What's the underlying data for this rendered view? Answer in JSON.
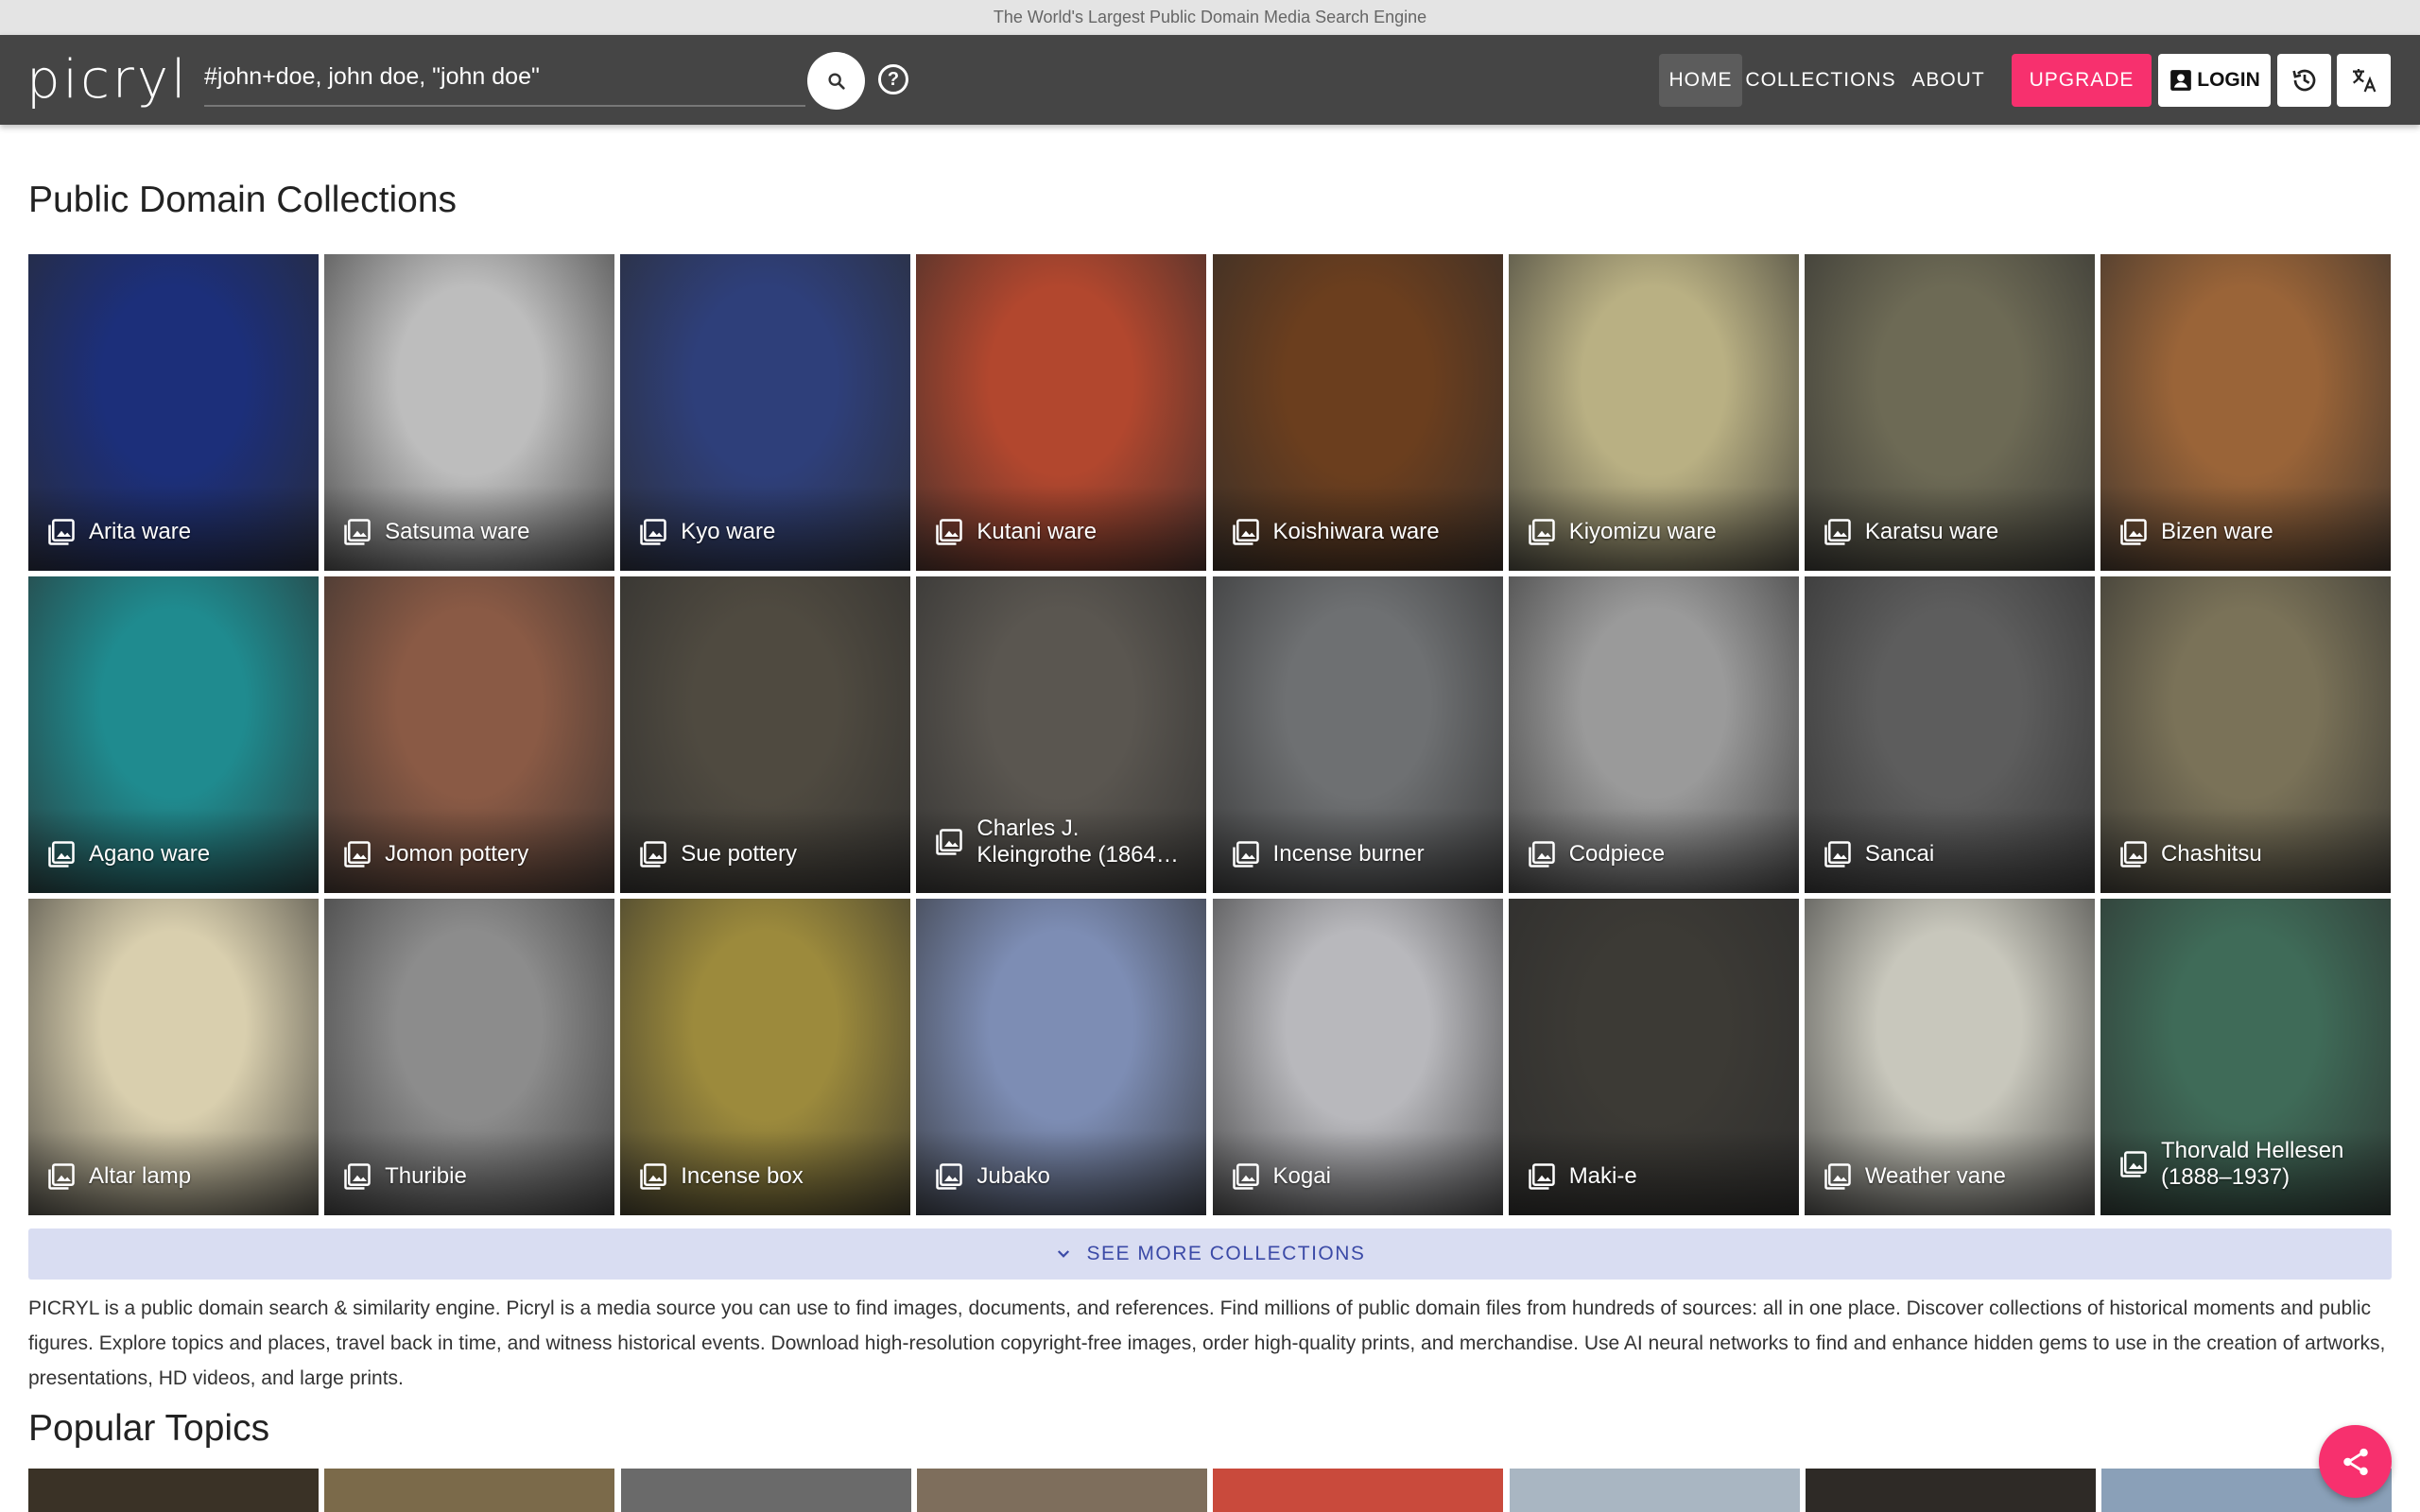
{
  "banner": {
    "text": "The World's Largest Public Domain Media Search Engine"
  },
  "header": {
    "logo": "picryl",
    "search_value": "#john+doe, john doe, \"john doe\"",
    "nav": [
      "HOME",
      "COLLECTIONS",
      "ABOUT"
    ],
    "upgrade": "UPGRADE",
    "login": "LOGIN"
  },
  "collections": {
    "title": "Public Domain Collections",
    "items": [
      {
        "label": "Arita ware",
        "bg": "#1c2f7a"
      },
      {
        "label": "Satsuma ware",
        "bg": "#bdbdbd"
      },
      {
        "label": "Kyo ware",
        "bg": "#2e3f7a"
      },
      {
        "label": "Kutani ware",
        "bg": "#b2472e"
      },
      {
        "label": "Koishiwara ware",
        "bg": "#6b3e1e"
      },
      {
        "label": "Kiyomizu ware",
        "bg": "#b9b083"
      },
      {
        "label": "Karatsu ware",
        "bg": "#6d6a55"
      },
      {
        "label": "Bizen ware",
        "bg": "#9a6438"
      },
      {
        "label": "Agano ware",
        "bg": "#1f8b8f"
      },
      {
        "label": "Jomon pottery",
        "bg": "#8a5a45"
      },
      {
        "label": "Sue pottery",
        "bg": "#4f4a40"
      },
      {
        "label": "Charles J. Kleingrothe (1864…",
        "bg": "#5a5650"
      },
      {
        "label": "Incense burner",
        "bg": "#6e7072"
      },
      {
        "label": "Codpiece",
        "bg": "#9a9a9a"
      },
      {
        "label": "Sancai",
        "bg": "#5d5d5d"
      },
      {
        "label": "Chashitsu",
        "bg": "#7a7258"
      },
      {
        "label": "Altar lamp",
        "bg": "#d9cfae"
      },
      {
        "label": "Thuribie",
        "bg": "#8c8c8c"
      },
      {
        "label": "Incense box",
        "bg": "#9c8a3c"
      },
      {
        "label": "Jubako",
        "bg": "#7d8db4"
      },
      {
        "label": "Kogai",
        "bg": "#b8b8bc"
      },
      {
        "label": "Maki-e",
        "bg": "#3c3a35"
      },
      {
        "label": "Weather vane",
        "bg": "#c8c7bc"
      },
      {
        "label": "Thorvald Hellesen (1888–1937)",
        "bg": "#3f6b58"
      }
    ]
  },
  "see_more": "SEE MORE COLLECTIONS",
  "description": "PICRYL is a public domain search & similarity engine. Picryl is a media source you can use to find images, documents, and references. Find millions of public domain files from hundreds of sources: all in one place. Discover collections of historical moments and public figures. Explore topics and places, travel back in time, and witness historical events. Download high-resolution copyright-free images, order high-quality prints, and merchandise. Use AI neural networks to find and enhance hidden gems to use in the creation of artworks, presentations, HD videos, and large prints.",
  "topics": {
    "title": "Popular Topics",
    "tiles": [
      "#3a3226",
      "#7b6a4a",
      "#6a6a6a",
      "#7e6e5c",
      "#c94a3c",
      "#a9b6c2",
      "#2e2a26",
      "#8aa0b8"
    ]
  },
  "colors": {
    "accent": "#f7306e",
    "header": "#454545",
    "see_more_bg": "#d9ddf2",
    "see_more_text": "#3b4aa7"
  },
  "icons": [
    "search-icon",
    "help-icon",
    "account-icon",
    "history-icon",
    "translate-icon",
    "image-icon",
    "chevron-down-icon",
    "share-icon"
  ]
}
